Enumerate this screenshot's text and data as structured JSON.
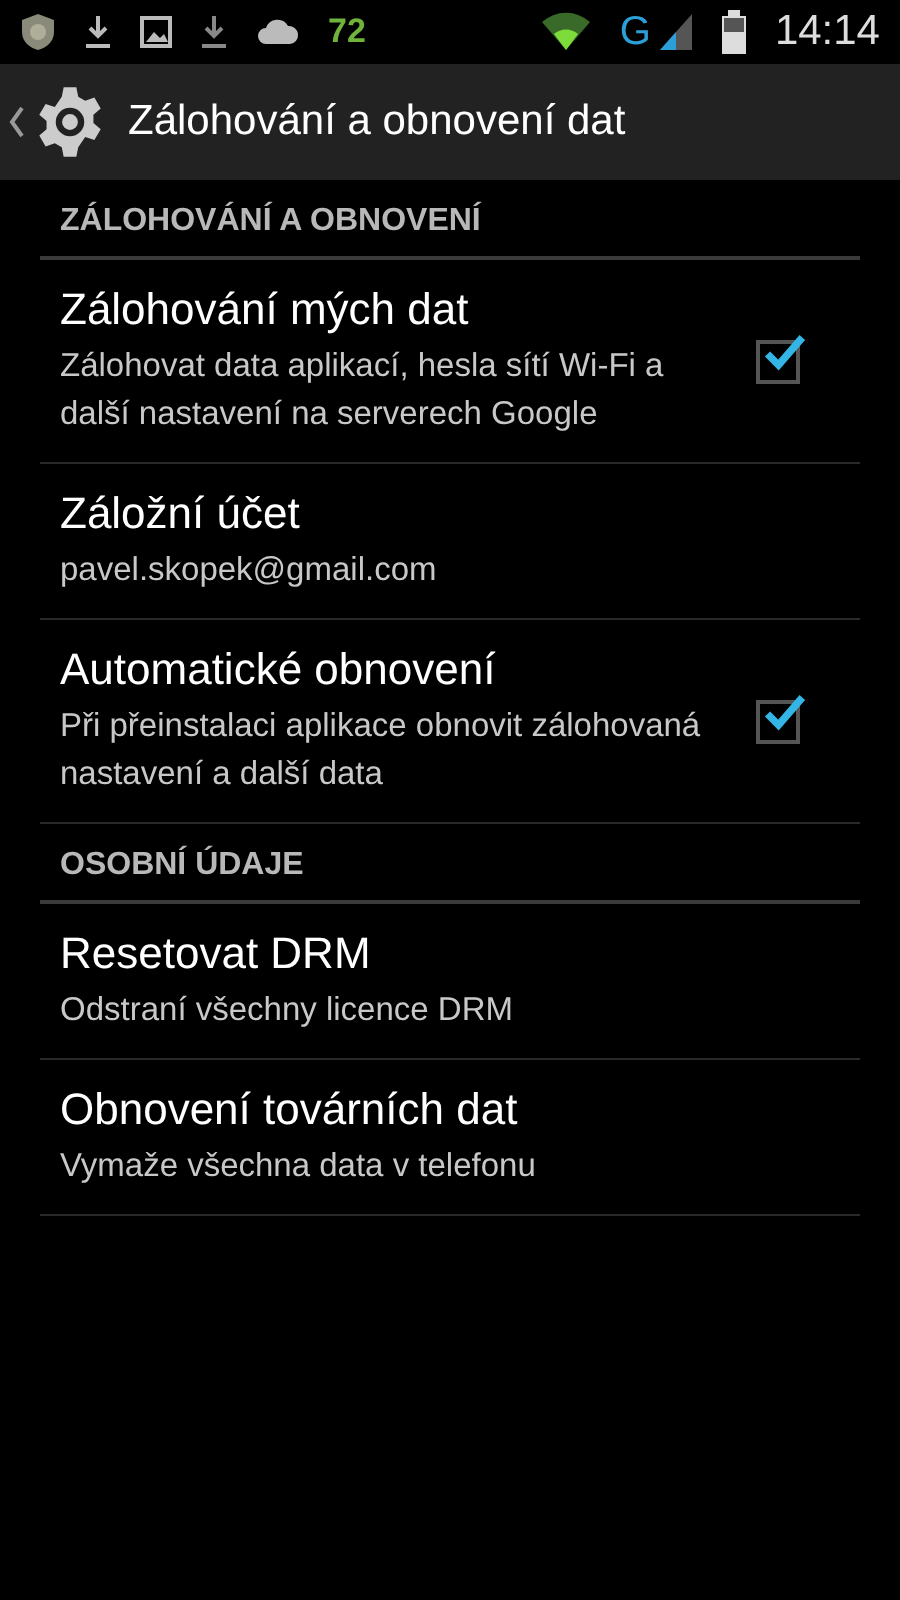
{
  "status_bar": {
    "badge": "72",
    "network": "G",
    "time": "14:14"
  },
  "action_bar": {
    "title": "Zálohování a obnovení dat"
  },
  "sections": [
    {
      "header": "ZÁLOHOVÁNÍ A OBNOVENÍ",
      "items": [
        {
          "kind": "checkbox",
          "title": "Zálohování mých dat",
          "summary": "Zálohovat data aplikací, hesla sítí Wi-Fi a další nastavení na serverech Google",
          "checked": true
        },
        {
          "kind": "plain",
          "title": "Záložní účet",
          "summary": "pavel.skopek@gmail.com"
        },
        {
          "kind": "checkbox",
          "title": "Automatické obnovení",
          "summary": "Při přeinstalaci aplikace obnovit zálohovaná nastavení a další data",
          "checked": true
        }
      ]
    },
    {
      "header": "OSOBNÍ ÚDAJE",
      "items": [
        {
          "kind": "plain",
          "title": "Resetovat DRM",
          "summary": "Odstraní všechny licence DRM"
        },
        {
          "kind": "plain",
          "title": "Obnovení továrních dat",
          "summary": "Vymaže všechna data v telefonu"
        }
      ]
    }
  ]
}
